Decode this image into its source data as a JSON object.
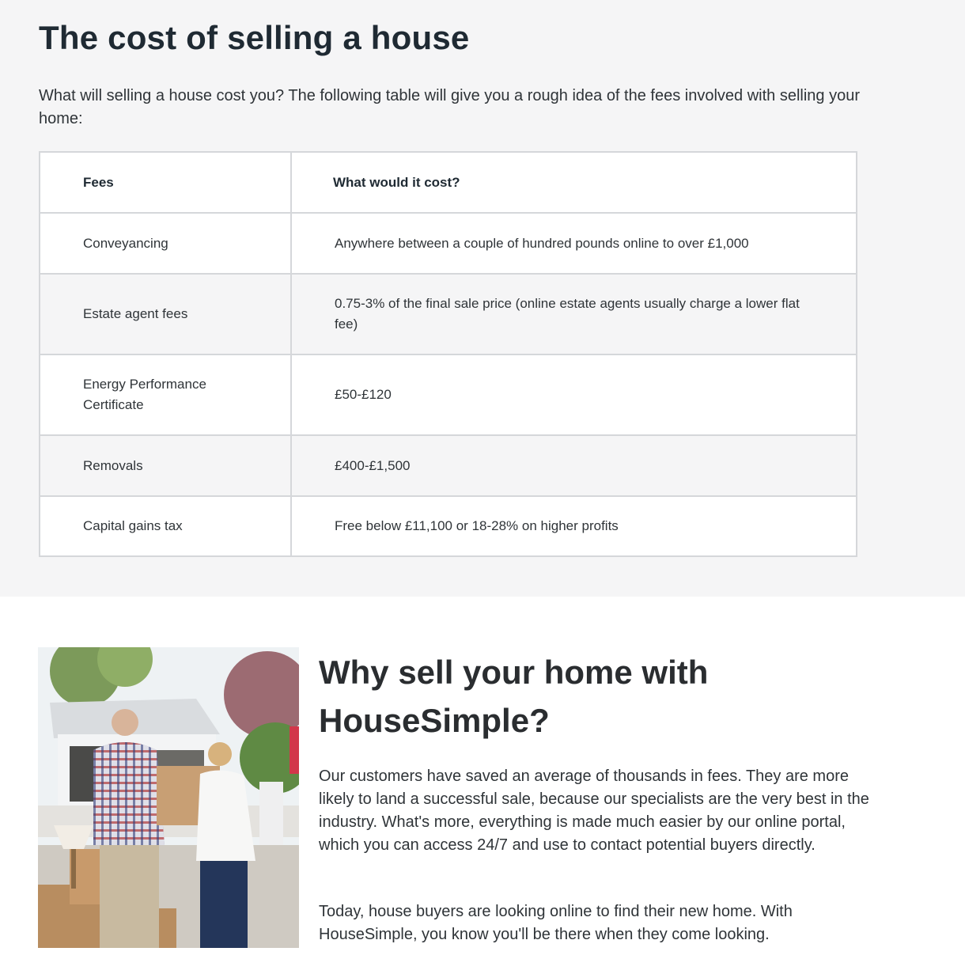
{
  "cost_section": {
    "title": "The cost of selling a house",
    "intro": "What will selling a house cost you? The following table will give you a rough idea of the fees involved with selling your home:",
    "table": {
      "headers": [
        "Fees",
        "What would it cost?"
      ],
      "rows": [
        {
          "fee": "Conveyancing",
          "cost": "Anywhere between a couple of hundred pounds online to over £1,000"
        },
        {
          "fee": "Estate agent fees",
          "cost": "0.75-3% of the final sale price (online estate agents usually charge a lower flat fee)"
        },
        {
          "fee": "Energy Performance Certificate",
          "cost": "£50-£120"
        },
        {
          "fee": "Removals",
          "cost": "£400-£1,500"
        },
        {
          "fee": "Capital gains tax",
          "cost": "Free below £11,100 or 18-28% on higher profits"
        }
      ]
    }
  },
  "why_section": {
    "title": "Why sell your home with HouseSimple?",
    "paragraph1": "Our customers have saved an average of thousands in fees. They are more likely to land a successful sale, because our specialists are the very best in the industry. What's more, everything is made much easier by our online portal, which you can access 24/7 and use to contact potential buyers directly.",
    "paragraph2": "Today, house buyers are looking online to find their new home. With HouseSimple, you know you'll be there when they come looking."
  }
}
